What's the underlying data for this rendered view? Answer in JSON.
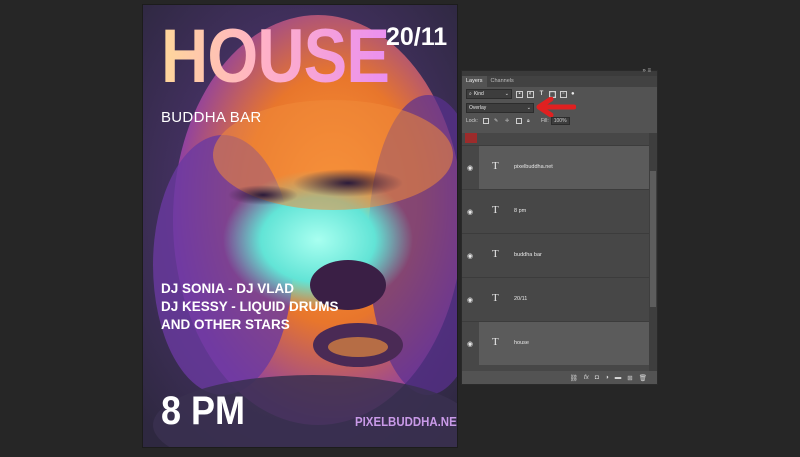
{
  "poster": {
    "title": "HOUSE",
    "date": "20/11",
    "venue": "BUDDHA BAR",
    "lineup": [
      "DJ SONIA - DJ VLAD",
      "DJ KESSY - LIQUID DRUMS",
      "AND OTHER STARS"
    ],
    "time": "8 PM",
    "url": "PIXELBUDDHA.NET"
  },
  "panel": {
    "tabs": [
      {
        "label": "Layers",
        "active": true
      },
      {
        "label": "Channels",
        "active": false
      }
    ],
    "window_controls": "»  ≡",
    "filter": {
      "kind_label": "Kind",
      "text_glyph": "T"
    },
    "blend_mode": "Overlay",
    "lock_label": "Lock:",
    "fill_label": "Fill:",
    "fill_value": "100%",
    "layers": [
      {
        "name": "pixelbuddha.net",
        "type_glyph": "T",
        "selected": true
      },
      {
        "name": "8 pm",
        "type_glyph": "T",
        "selected": false
      },
      {
        "name": "buddha bar",
        "type_glyph": "T",
        "selected": false
      },
      {
        "name": "20/11",
        "type_glyph": "T",
        "selected": false
      },
      {
        "name": "house",
        "type_glyph": "T",
        "selected": true
      }
    ],
    "bottom_icons": [
      "link-icon",
      "fx-icon",
      "mask-icon",
      "adjustment-icon",
      "folder-icon",
      "new-layer-icon",
      "trash-icon"
    ]
  },
  "colors": {
    "background": "#262626",
    "panel": "#535353",
    "arrow": "#e02020",
    "accent_purple": "#c99ae8"
  }
}
